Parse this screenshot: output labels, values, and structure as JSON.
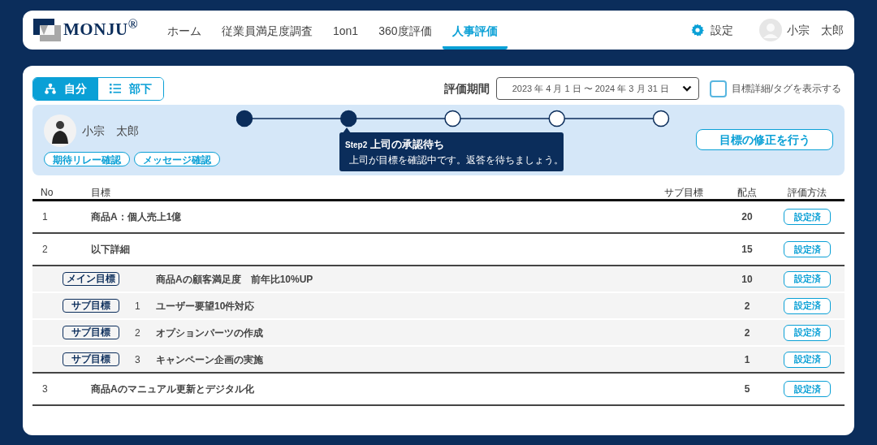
{
  "header": {
    "logo": "MONJU$^{®}$",
    "nav": [
      {
        "label": "ホーム",
        "selected": false
      },
      {
        "label": "従業員満足度調査",
        "selected": false
      },
      {
        "label": "1on1",
        "selected": false
      },
      {
        "label": "360度評価",
        "selected": false
      },
      {
        "label": "人事評価",
        "selected": true
      }
    ],
    "settings": "設定",
    "user": "小宗　太郎"
  },
  "view_toggle": [
    {
      "label": "自分",
      "kind": "tree",
      "selected": true
    },
    {
      "label": "部下",
      "kind": "list",
      "selected": false
    }
  ],
  "period": {
    "label": "評価期間",
    "value": "2023 年 4 月 1 日 〜 2024 年 3 月 31 日"
  },
  "show_details": {
    "label": "目標詳細/タグを表示する",
    "checked": false
  },
  "status_panel": {
    "name": "小宗　太郎",
    "links": [
      "期待リレー確認",
      "メッセージ確認"
    ],
    "steps": [
      {
        "done": true
      },
      {
        "done": true
      },
      {
        "done": false
      },
      {
        "done": false
      },
      {
        "done": false
      }
    ],
    "callout": {
      "step": "Step2",
      "title": "上司の承認待ち",
      "text": "上司が目標を確認中です。返答を待ちましょう。"
    },
    "action": "目標の修正を行う"
  },
  "table": {
    "columns": [
      "No",
      "目標",
      "サブ目標",
      "配点",
      "評価方法"
    ],
    "rows": [
      {
        "kind": "goal",
        "no": "1",
        "goal": "商品A：個人売上1億",
        "score": "20",
        "method": "設定済"
      },
      {
        "kind": "goal",
        "no": "2",
        "goal": "以下詳細",
        "score": "15",
        "method": "設定済"
      },
      {
        "kind": "detail",
        "tag": "メイン目標",
        "goal": "商品Aの顧客満足度　前年比10%UP",
        "score": "10",
        "method": "設定済"
      },
      {
        "kind": "detail",
        "tag": "サブ目標",
        "sub_no": "1",
        "goal": "ユーザー要望10件対応",
        "score": "2",
        "method": "設定済"
      },
      {
        "kind": "detail",
        "tag": "サブ目標",
        "sub_no": "2",
        "goal": "オプションパーツの作成",
        "score": "2",
        "method": "設定済"
      },
      {
        "kind": "detail",
        "tag": "サブ目標",
        "sub_no": "3",
        "goal": "キャンペーン企画の実施",
        "score": "1",
        "method": "設定済"
      },
      {
        "kind": "goal",
        "no": "3",
        "goal": "商品Aのマニュアル更新とデジタル化",
        "score": "5",
        "method": "設定済"
      }
    ]
  }
}
